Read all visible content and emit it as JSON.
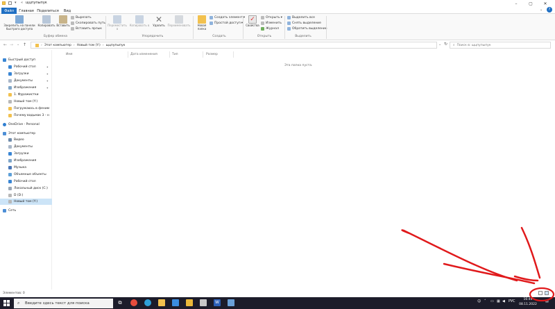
{
  "window": {
    "title_path": "«",
    "title_folder": "щцпупыпук"
  },
  "ribbon_tabs": [
    "Файл",
    "Главная",
    "Поделиться",
    "Вид"
  ],
  "clipboard": {
    "pin_label": "Закрепить на панели быстрого доступа",
    "copy_label": "Копировать",
    "paste_label": "Вставить",
    "cut_label": "Вырезать",
    "copy_path_label": "Скопировать путь",
    "paste_shortcut_label": "Вставить ярлык",
    "group_label": "Буфер обмена"
  },
  "organize": {
    "move_label": "Переместить в",
    "copy_to_label": "Копировать в",
    "delete_label": "Удалить",
    "rename_label": "Переименовать",
    "group_label": "Упорядочить"
  },
  "create": {
    "new_folder_label": "Новая папка",
    "new_item_label": "Создать элемент",
    "easy_access_label": "Простой доступ",
    "group_label": "Создать"
  },
  "open": {
    "properties_label": "Свойства",
    "open_label": "Открыть",
    "edit_label": "Изменить",
    "history_label": "Журнал",
    "group_label": "Открыть"
  },
  "select": {
    "select_all_label": "Выделить все",
    "select_none_label": "Снять выделение",
    "invert_label": "Обратить выделение",
    "group_label": "Выделить"
  },
  "address": {
    "crumbs": [
      "Этот компьютер",
      "Новый том (Y:)",
      "щцпупыпук"
    ],
    "search_placeholder": "Поиск в: щцпупыпук"
  },
  "nav": {
    "quick_access": "Быстрый доступ",
    "desktop": "Рабочий стол",
    "downloads": "Загрузки",
    "documents": "Документы",
    "images": "Изображения",
    "fur": "1. Фуражистки",
    "new_vol": "Новый том (Y:)",
    "immersion": "Погружаюсь в феним",
    "why": "Почему вадьмак 3 - н",
    "onedrive": "OneDrive - Personal",
    "this_pc": "Этот компьютер",
    "video": "Видео",
    "pc_documents": "Документы",
    "pc_downloads": "Загрузки",
    "pc_images": "Изображения",
    "music": "Музыка",
    "objects3d": "Объемные объекты",
    "pc_desktop": "Рабочий стол",
    "local_c": "Локальный диск (C:)",
    "d_drive": "D (D:)",
    "y_drive": "Новый том (Y:)",
    "network": "Сеть"
  },
  "columns": {
    "name": "Имя",
    "date": "Дата изменения",
    "type": "Тип",
    "size": "Размер"
  },
  "empty_text": "Эта папка пуста.",
  "status": {
    "items": "Элементов: 0"
  },
  "taskbar": {
    "search_placeholder": "Введите здесь текст для поиска",
    "lang": "РУС",
    "time": "16:49",
    "date": "08.11.2022"
  },
  "colors": {
    "accent": "#1f6fc3",
    "taskbar": "#1c1c2a",
    "annotation": "#e0191b"
  }
}
